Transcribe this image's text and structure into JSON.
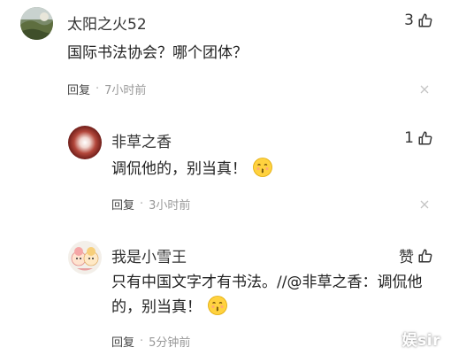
{
  "comments": [
    {
      "username": "太阳之火52",
      "text": "国际书法协会？哪个团体？",
      "likes": "3",
      "reply_label": "回复",
      "separator": "·",
      "time": "7小时前",
      "avatar_icon": "landscape-avatar"
    },
    {
      "username": "非草之香",
      "text": "调侃他的，别当真！",
      "likes": "1",
      "reply_label": "回复",
      "separator": "·",
      "time": "3小时前",
      "avatar_icon": "red-orb-avatar",
      "emoji": "kissing-face-emoji"
    },
    {
      "username": "我是小雪王",
      "text": "只有中国文字才有书法。//@非草之香：调侃他的，别当真！",
      "likes": "赞",
      "reply_label": "回复",
      "separator": "·",
      "time": "5分钟前",
      "avatar_icon": "cartoon-pair-avatar",
      "emoji": "kissing-face-emoji"
    }
  ],
  "watermark": "娱sir",
  "colors": {
    "text": "#222222",
    "muted": "#999999",
    "background": "#ffffff"
  }
}
